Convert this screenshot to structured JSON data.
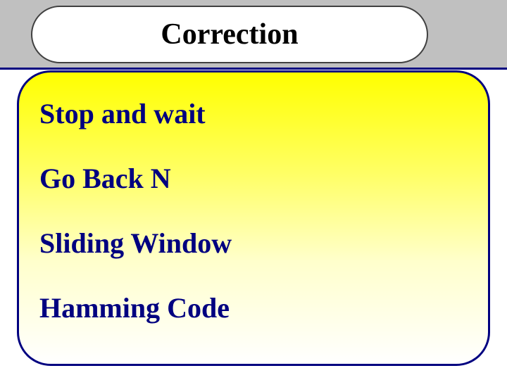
{
  "title": "Correction",
  "items": [
    "Stop and wait",
    "Go Back N",
    "Sliding Window",
    "Hamming Code"
  ]
}
